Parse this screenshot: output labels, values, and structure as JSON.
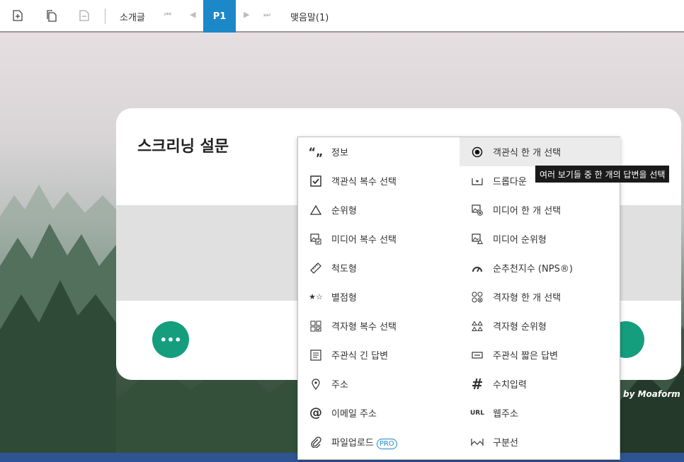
{
  "toolbar": {
    "intro_label": "소개글",
    "page_label": "P1",
    "outro_label": "맺음말(1)"
  },
  "card": {
    "title": "스크리닝 설문",
    "more_label": "•••"
  },
  "credit": "by Moaform",
  "menu": {
    "left": [
      {
        "icon": "quote-icon",
        "label": "정보"
      },
      {
        "icon": "checkbox-icon",
        "label": "객관식 복수 선택"
      },
      {
        "icon": "triangle-icon",
        "label": "순위형"
      },
      {
        "icon": "media-checkbox-icon",
        "label": "미디어 복수 선택"
      },
      {
        "icon": "ruler-icon",
        "label": "척도형"
      },
      {
        "icon": "stars-icon",
        "label": "별점형"
      },
      {
        "icon": "grid-checkbox-icon",
        "label": "격자형 복수 선택"
      },
      {
        "icon": "long-text-icon",
        "label": "주관식 긴 답변"
      },
      {
        "icon": "location-pin-icon",
        "label": "주소"
      },
      {
        "icon": "at-icon",
        "label": "이메일 주소"
      },
      {
        "icon": "paperclip-icon",
        "label": "파일업로드",
        "badge": "PRO"
      }
    ],
    "right": [
      {
        "icon": "radio-icon",
        "label": "객관식 한 개 선택"
      },
      {
        "icon": "dropdown-icon",
        "label": "드롭다운"
      },
      {
        "icon": "media-radio-icon",
        "label": "미디어 한 개 선택"
      },
      {
        "icon": "media-rank-icon",
        "label": "미디어 순위형"
      },
      {
        "icon": "gauge-icon",
        "label": "순추천지수 (NPS®)"
      },
      {
        "icon": "grid-radio-icon",
        "label": "격자형 한 개 선택"
      },
      {
        "icon": "grid-rank-icon",
        "label": "격자형 순위형"
      },
      {
        "icon": "short-text-icon",
        "label": "주관식 짧은 답변"
      },
      {
        "icon": "hash-icon",
        "label": "수치입력"
      },
      {
        "icon": "url-icon",
        "label": "웹주소"
      },
      {
        "icon": "divider-icon",
        "label": "구분선"
      }
    ],
    "selected": "객관식 한 개 선택"
  },
  "tooltip": "여러 보기들 중 한 개의 답변을 선택",
  "colors": {
    "accent": "#1c88c8",
    "green": "#159e7e",
    "footer": "#2e5592"
  }
}
